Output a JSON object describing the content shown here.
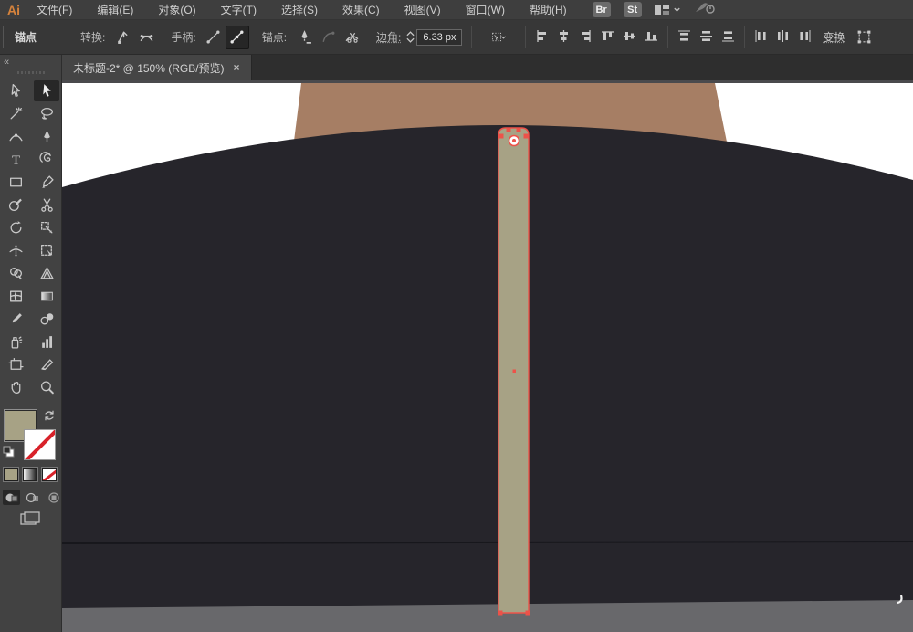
{
  "menubar": {
    "logo": "Ai",
    "items": [
      "文件(F)",
      "编辑(E)",
      "对象(O)",
      "文字(T)",
      "选择(S)",
      "效果(C)",
      "视图(V)",
      "窗口(W)",
      "帮助(H)"
    ],
    "br": "Br",
    "st": "St"
  },
  "controlbar": {
    "context": "锚点",
    "convert_label": "转换:",
    "handles_label": "手柄:",
    "anchors_label": "锚点:",
    "corner_label": "边角:",
    "corner_value": "6.33 px",
    "transform_label": "变换"
  },
  "tab": {
    "title": "未标题-2* @ 150% (RGB/预览)",
    "close": "×"
  },
  "toolbar": {
    "collapse": "«"
  },
  "canvas": {
    "zoom": "150%",
    "colors": {
      "artboard": "#ffffff",
      "pasteboard": "#4a4a4d",
      "neck": "#a67e64",
      "jacket": "#26252b",
      "seam": "#17171c",
      "floor": "#68686b",
      "tie": "#a7a285",
      "selection": "#ed5249"
    }
  },
  "swatches": {
    "fill": "#a7a285",
    "stroke": "none"
  }
}
